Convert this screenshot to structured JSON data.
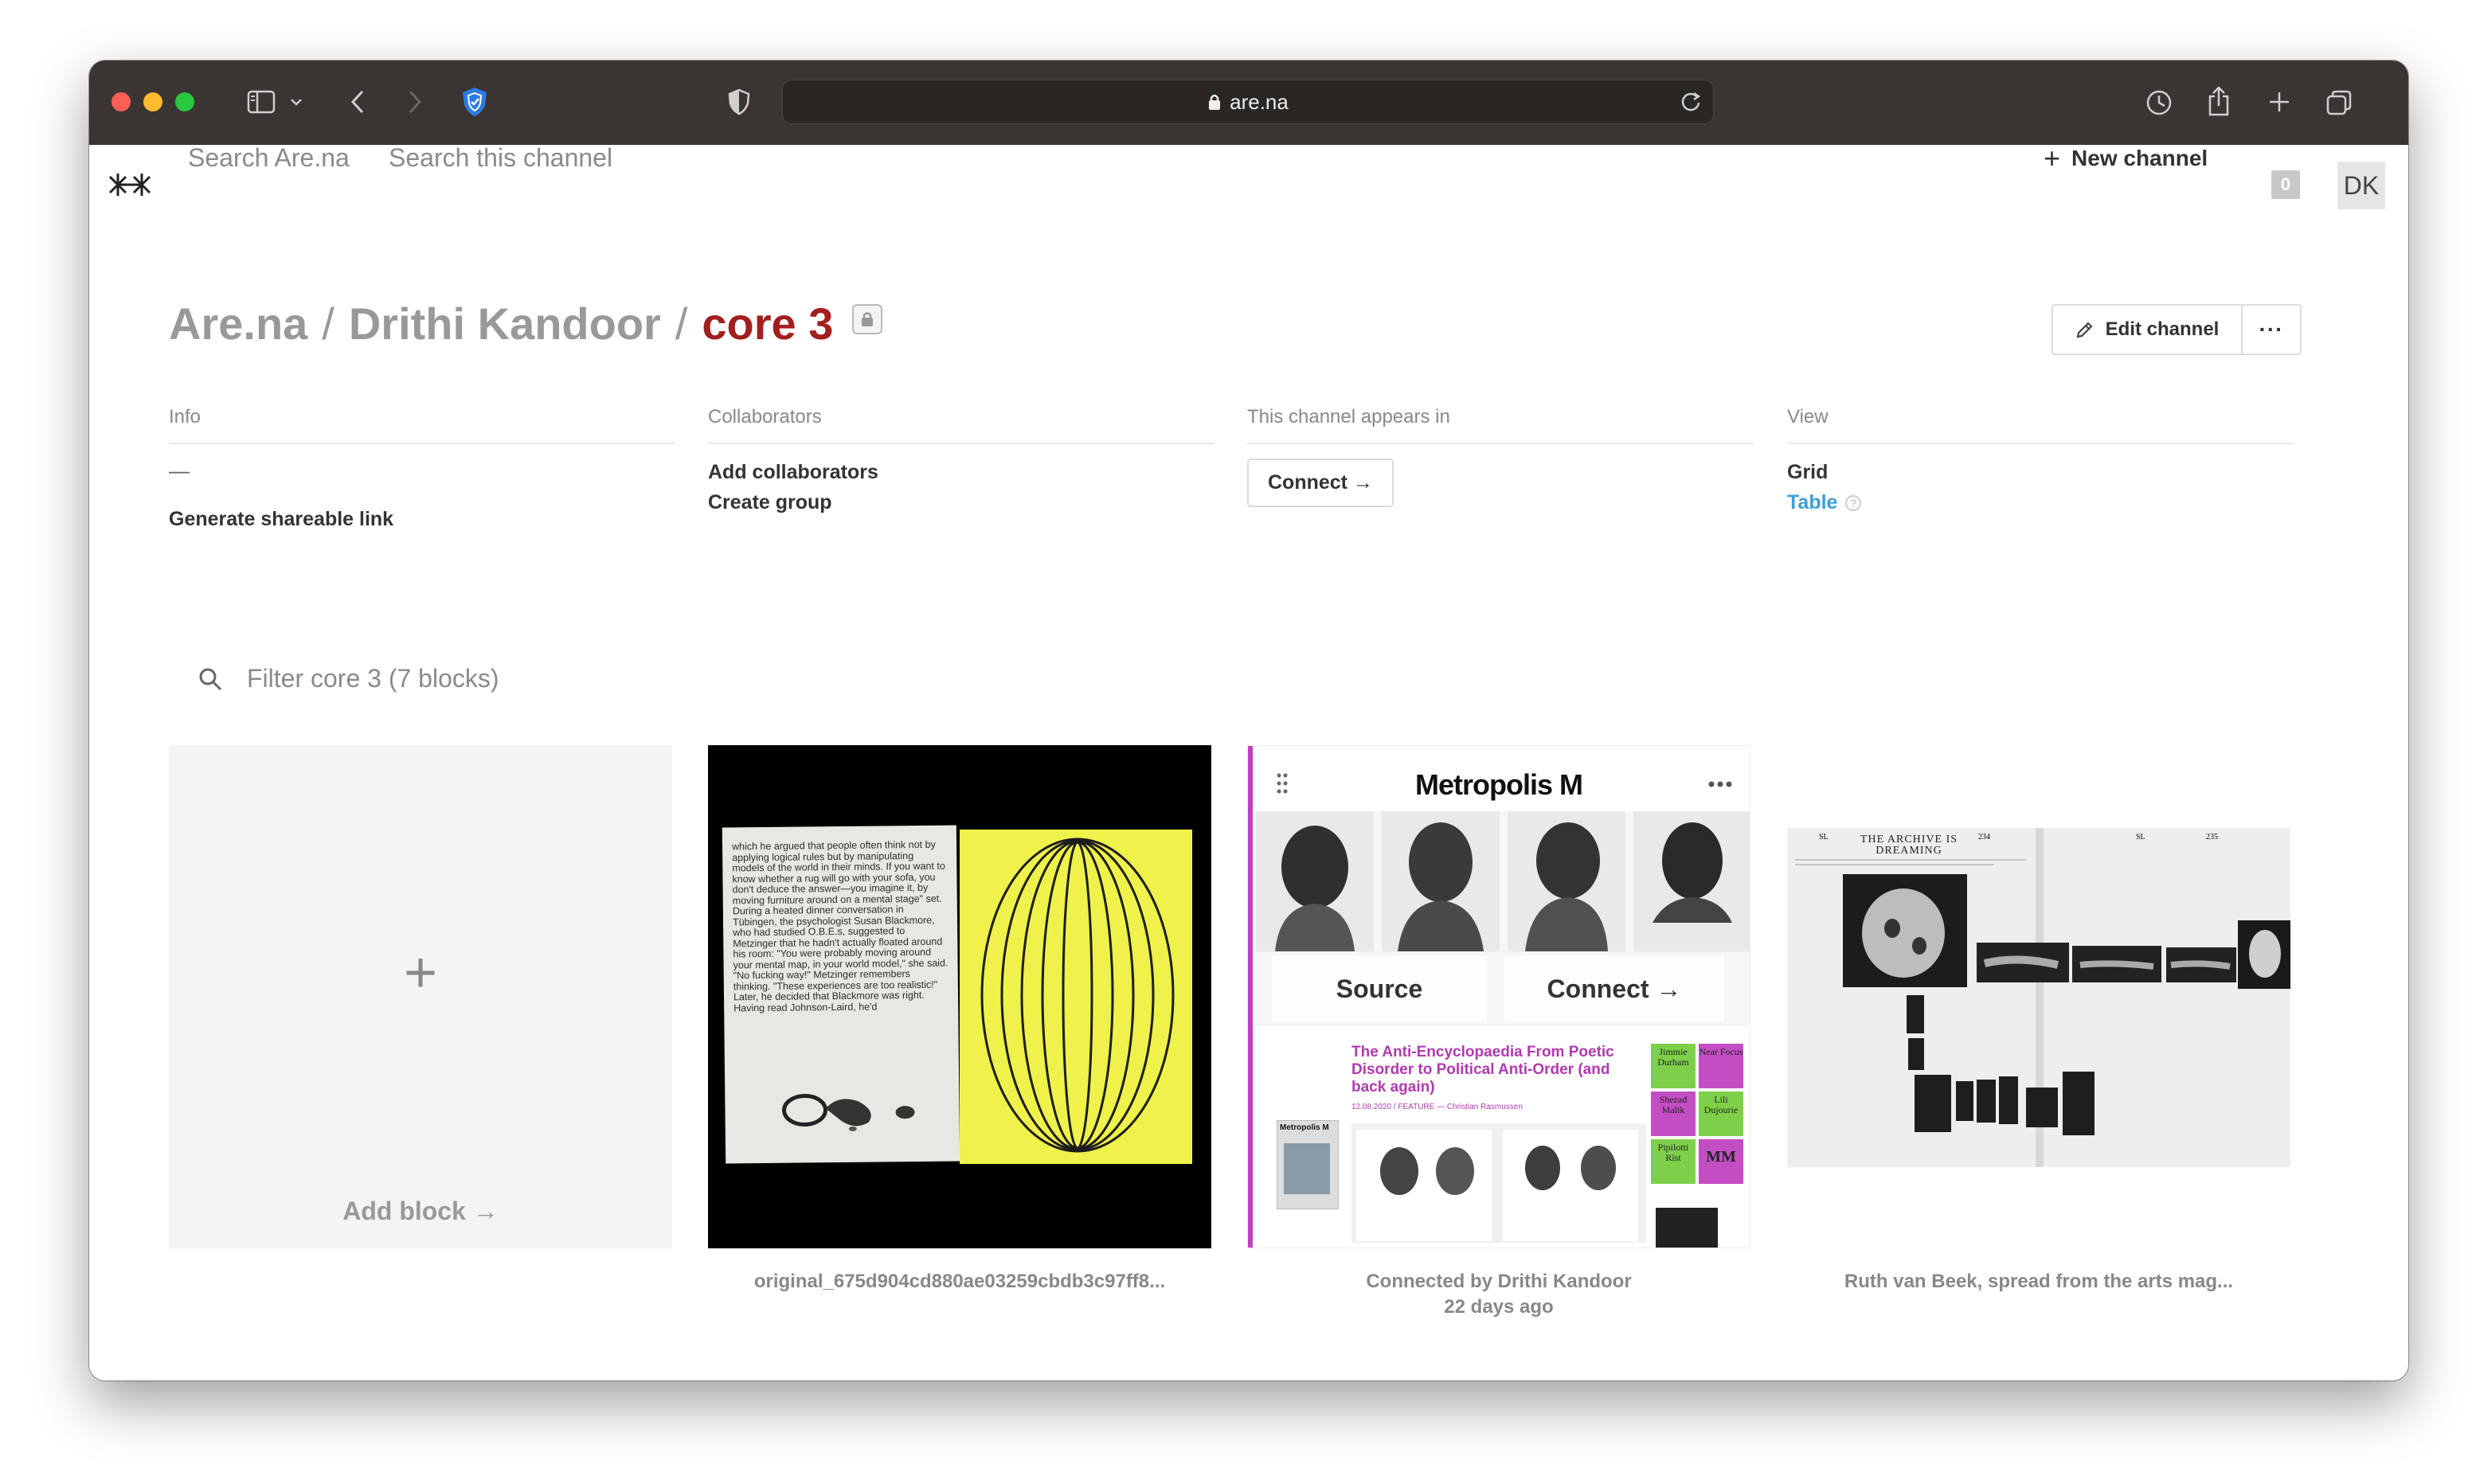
{
  "browser": {
    "url": "are.na",
    "icons": [
      "sidebar-icon",
      "chevron-down-icon",
      "back-icon",
      "forward-icon",
      "privacy-shield-icon",
      "half-shield-icon",
      "lock-icon",
      "reload-icon",
      "history-icon",
      "share-icon",
      "new-tab-icon",
      "tabs-overview-icon"
    ]
  },
  "nav": {
    "logo_icon": "arena-logo-icon",
    "search_all": "Search Are.na",
    "search_channel": "Search this channel",
    "new_channel": "New channel",
    "notifications": "0",
    "avatar": "DK"
  },
  "header": {
    "crumb_root": "Are.na",
    "crumb_user": "Drithi Kandoor",
    "crumb_channel": "core 3",
    "sep": "/",
    "edit_label": "Edit channel",
    "more_label": "···"
  },
  "meta": {
    "info": {
      "head": "Info",
      "desc": "—",
      "share_link": "Generate shareable link"
    },
    "collaborators": {
      "head": "Collaborators",
      "add": "Add collaborators",
      "group": "Create group"
    },
    "appears": {
      "head": "This channel appears in",
      "connect": "Connect →"
    },
    "view": {
      "head": "View",
      "grid": "Grid",
      "table": "Table",
      "help": "?"
    }
  },
  "filter": {
    "placeholder": "Filter core 3 (7 blocks)"
  },
  "blocks": {
    "add": {
      "plus": "+",
      "label": "Add block →"
    },
    "b1": {
      "caption": "original_675d904cd880ae03259cbdb3c97ff8...",
      "page_text": "which he argued that people often think not by applying logical rules but by manipulating models of the world in their minds. If you want to know whether a rug will go with your sofa, you don't deduce the answer—you imagine it, by moving furniture around on a mental stage\" set. During a heated dinner conversation in Tübingen, the psychologist Susan Blackmore, who had studied O.B.E.s, suggested to Metzinger that he hadn't actually floated around his room: \"You were probably moving around your mental map, in your world model,\" she said. \"No fucking way!\" Metzinger remembers thinking. \"These experiences are too realistic!\" Later, he decided that Blackmore was right. Having read Johnson-Laird, he'd"
    },
    "b2": {
      "caption_line1": "Connected by Drithi Kandoor",
      "caption_line2": "22 days ago",
      "source_btn": "Source",
      "connect_btn": "Connect →",
      "mag_title": "Metropolis M",
      "headline": "The Anti-Encyclopaedia From Poetic Disorder to Political Anti-Order (and back again)",
      "sub": "12.08.2020 / FEATURE — Christian Rasmussen",
      "cover_title": "Metropolis M",
      "grid_cells": [
        "Jimmie Durham",
        "Near Focus",
        "Shezad Malik",
        "Lili Dujourie",
        "Pipilotti Rist",
        "MM"
      ]
    },
    "b3": {
      "caption": "Ruth van Beek, spread from the arts mag...",
      "spread_title": "THE ARCHIVE IS DREAMING",
      "page_left": "234",
      "page_right": "235",
      "running_left": "SL",
      "running_right": "SL"
    }
  }
}
